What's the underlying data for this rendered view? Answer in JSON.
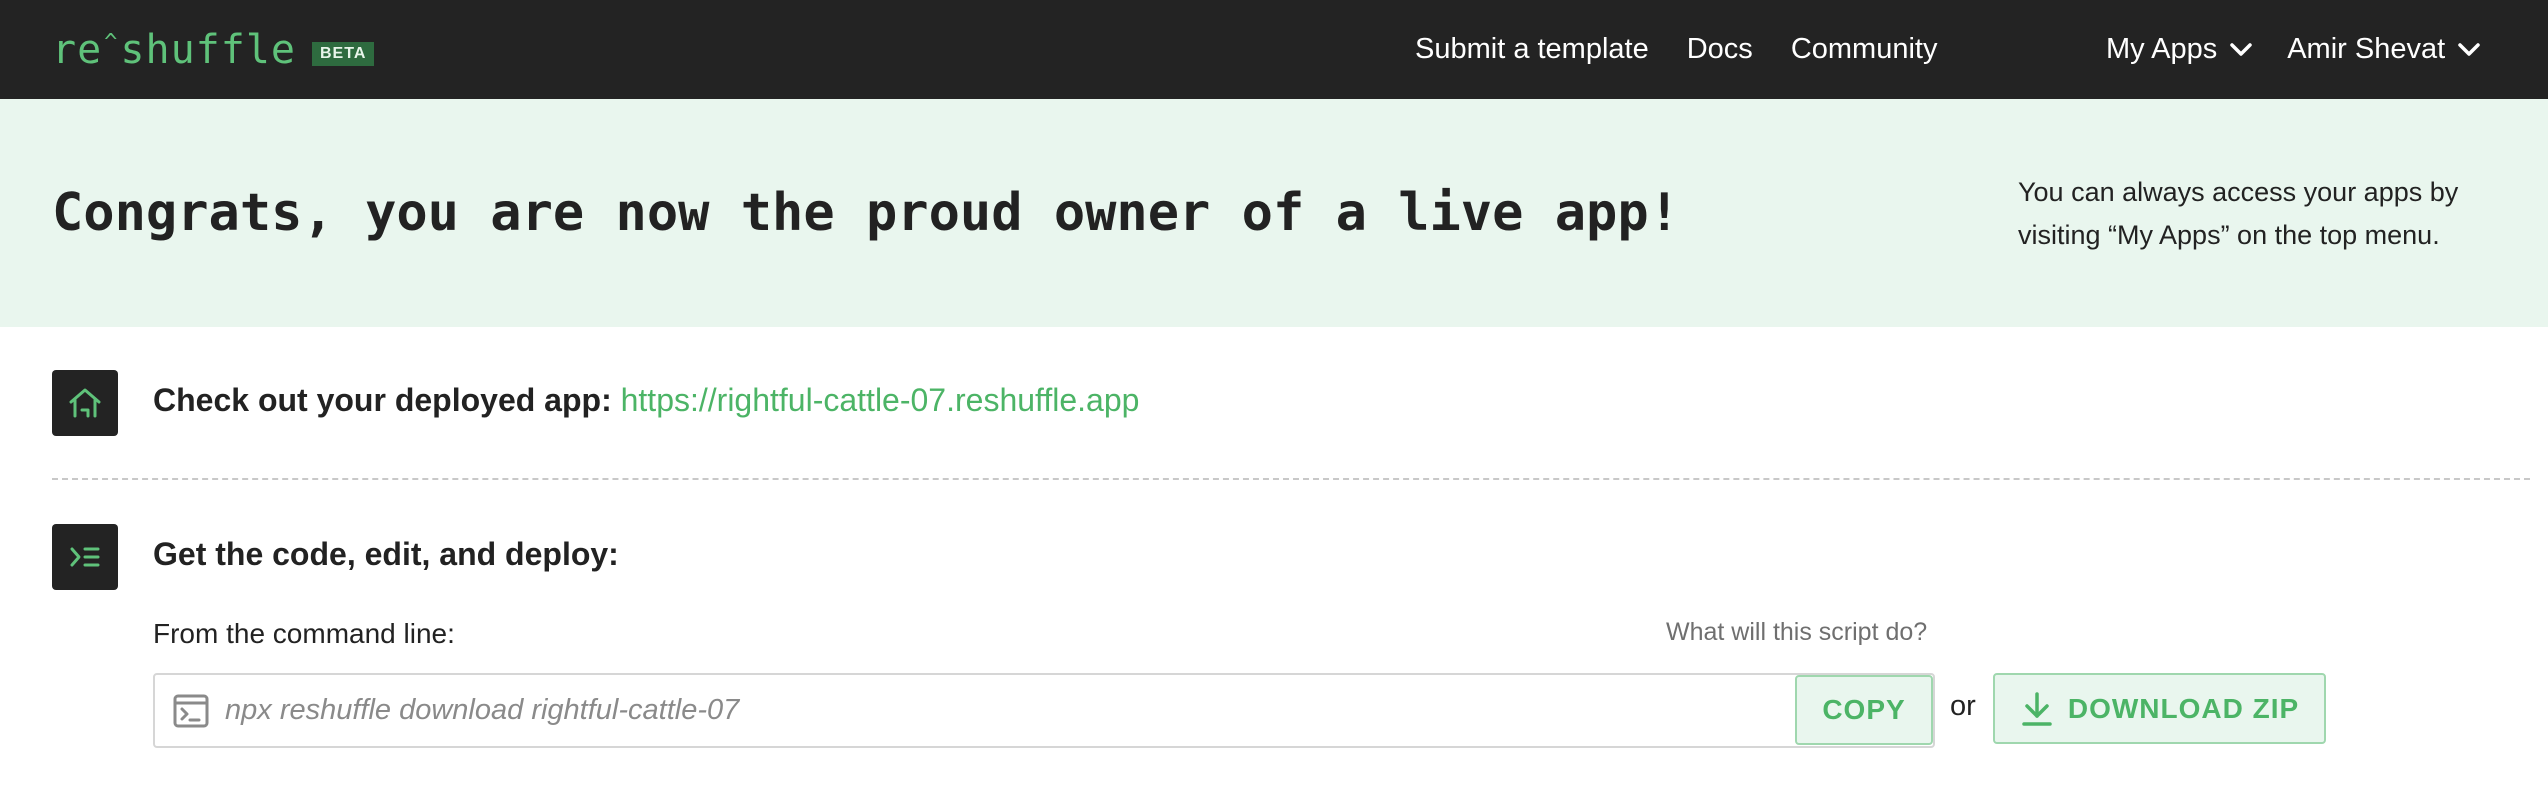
{
  "brand": {
    "logo_prefix": "re",
    "logo_caret": "^",
    "logo_suffix": "shuffle",
    "badge": "BETA"
  },
  "nav": {
    "links": [
      "Submit a template",
      "Docs",
      "Community"
    ],
    "my_apps": "My Apps",
    "user": "Amir Shevat"
  },
  "hero": {
    "title_plain": "Congrats, you are now the proud owner of a ",
    "title_bold": "live app!",
    "note": "You can always access your apps by visiting “My Apps” on the top menu."
  },
  "deployed": {
    "label": "Check out your deployed app:",
    "url": "https://rightful-cattle-07.reshuffle.app"
  },
  "code": {
    "title": "Get the code, edit, and deploy:",
    "cmd_label": "From the command line:",
    "help_link": "What will this script do?",
    "command": "npx reshuffle download rightful-cattle-07",
    "copy_label": "COPY",
    "or_text": "or",
    "download_label": "DOWNLOAD ZIP"
  },
  "colors": {
    "accent": "#4cb466",
    "topbar": "#232323",
    "hero_bg": "#e9f6ee"
  },
  "icons": {
    "section1": "home-icon",
    "section2": "terminal-list-icon",
    "dropdown": "chevron-down-icon",
    "command": "terminal-icon",
    "download": "download-icon"
  }
}
